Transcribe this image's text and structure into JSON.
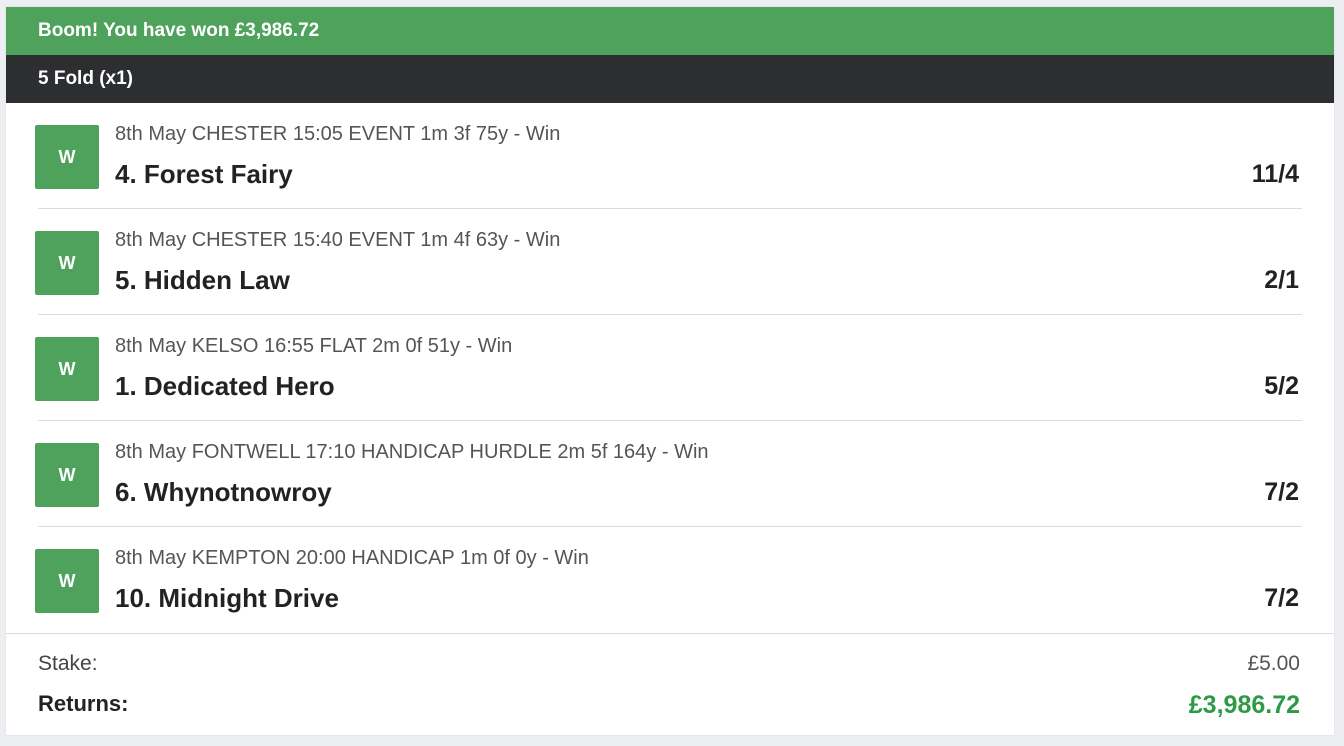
{
  "banner": {
    "text": "Boom! You have won £3,986.72"
  },
  "bet": {
    "type_label": "5 Fold (x1)"
  },
  "selections": [
    {
      "badge": "W",
      "event": "8th May CHESTER 15:05 EVENT 1m 3f 75y - Win",
      "runner": "4. Forest Fairy",
      "odds": "11/4"
    },
    {
      "badge": "W",
      "event": "8th May CHESTER 15:40 EVENT 1m 4f 63y - Win",
      "runner": "5. Hidden Law",
      "odds": "2/1"
    },
    {
      "badge": "W",
      "event": "8th May KELSO 16:55 FLAT 2m 0f 51y - Win",
      "runner": "1. Dedicated Hero",
      "odds": "5/2"
    },
    {
      "badge": "W",
      "event": "8th May FONTWELL 17:10 HANDICAP HURDLE 2m 5f 164y - Win",
      "runner": "6. Whynotnowroy",
      "odds": "7/2"
    },
    {
      "badge": "W",
      "event": "8th May KEMPTON 20:00 HANDICAP 1m 0f 0y - Win",
      "runner": "10. Midnight Drive",
      "odds": "7/2"
    }
  ],
  "footer": {
    "stake_label": "Stake:",
    "stake_value": "£5.00",
    "returns_label": "Returns:",
    "returns_value": "£3,986.72"
  },
  "colors": {
    "win_green": "#4ea25c",
    "header_dark": "#2d2e30",
    "returns_green": "#2c9b44"
  }
}
